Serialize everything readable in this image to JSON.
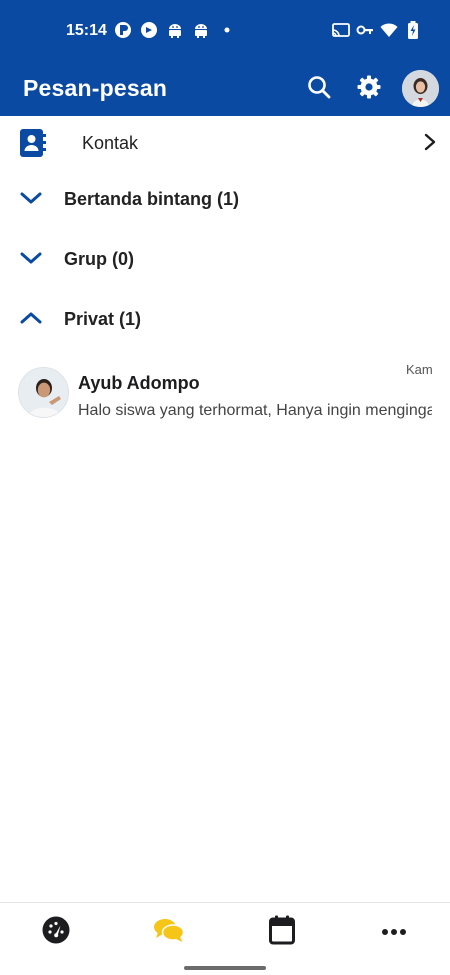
{
  "status_bar": {
    "time": "15:14",
    "left_icons": [
      "sync-icon",
      "refresh-icon",
      "android-icon",
      "android-icon",
      "dot-icon"
    ],
    "right_icons": [
      "cast-icon",
      "vpn-key-icon",
      "wifi-icon",
      "battery-charging-icon"
    ]
  },
  "app_bar": {
    "title": "Pesan-pesan",
    "background": "#0b4aa2",
    "actions": [
      "search-icon",
      "settings-icon",
      "profile-avatar"
    ]
  },
  "contacts_row": {
    "label": "Kontak",
    "icon": "contacts-book-icon",
    "accent": "#0b4aa2"
  },
  "sections": [
    {
      "label": "Bertanda bintang (1)",
      "expanded": false
    },
    {
      "label": "Grup (0)",
      "expanded": false
    },
    {
      "label": "Privat (1)",
      "expanded": true
    }
  ],
  "messages": [
    {
      "sender": "Ayub Adompo",
      "time": "Kam",
      "preview": "Halo siswa yang terhormat, Hanya ingin mengingatkan"
    }
  ],
  "bottom_nav": {
    "items": [
      "dashboard-icon",
      "messages-icon",
      "calendar-icon",
      "more-icon"
    ],
    "active_index": 1,
    "active_color": "#f5c518"
  }
}
